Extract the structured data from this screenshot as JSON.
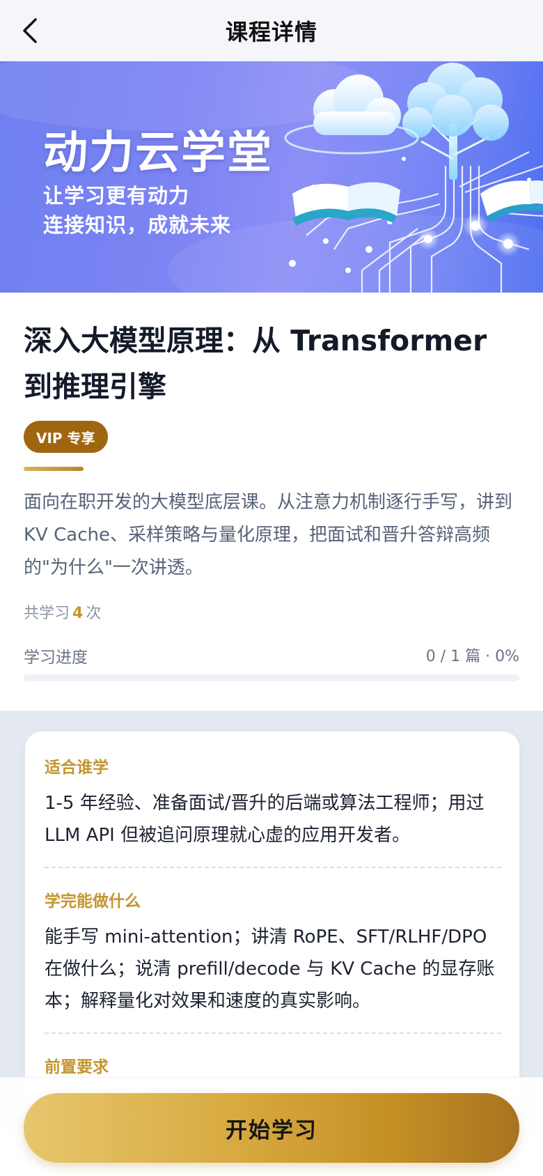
{
  "header": {
    "title": "课程详情",
    "back_icon": "chevron-left-icon"
  },
  "banner": {
    "title": "动力云学堂",
    "line1": "让学习更有动力",
    "line2": "连接知识，成就未来"
  },
  "course": {
    "title": "深入大模型原理：从 Transformer 到推理引擎",
    "badge": "VIP 专享",
    "description": "面向在职开发的大模型底层课。从注意力机制逐行手写，讲到 KV Cache、采样策略与量化原理，把面试和晋升答辩高频的\"为什么\"一次讲透。",
    "study_count_prefix": "共学习",
    "study_count": "4",
    "study_count_suffix": "次",
    "progress_label": "学习进度",
    "progress_text": "0 / 1 篇 · 0%",
    "progress_fraction": 0
  },
  "details": {
    "sections": [
      {
        "heading": "适合谁学",
        "body": "1-5 年经验、准备面试/晋升的后端或算法工程师；用过 LLM API 但被追问原理就心虚的应用开发者。"
      },
      {
        "heading": "学完能做什么",
        "body": "能手写 mini-attention；讲清 RoPE、SFT/RLHF/DPO 在做什么；说清 prefill/decode 与 KV Cache 的显存账本；解释量化对效果和速度的真实影响。"
      },
      {
        "heading": "前置要求",
        "body": ""
      }
    ]
  },
  "actions": {
    "start_label": "开始学习"
  },
  "colors": {
    "accent_gold": "#c4952f",
    "vip_badge": "#a0650f",
    "banner_blue": "#7c84f3"
  }
}
